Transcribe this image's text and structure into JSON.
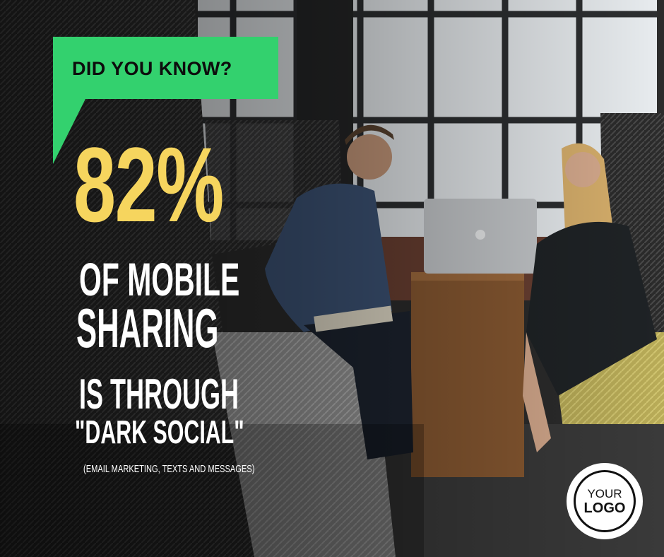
{
  "callout": {
    "text": "DID YOU KNOW?"
  },
  "stat": {
    "value": "82%"
  },
  "headline": {
    "line1": "OF MOBILE",
    "line2": "SHARING",
    "line3": "IS THROUGH",
    "line4": "\"DARK SOCIAL\"",
    "note": "(EMAIL MARKETING, TEXTS AND MESSAGES)"
  },
  "logo": {
    "line1": "YOUR",
    "line2": "LOGO"
  },
  "colors": {
    "callout_bg": "#33d16e",
    "stat": "#f6d55e",
    "text": "#ffffff",
    "logo_ring": "#111111"
  }
}
